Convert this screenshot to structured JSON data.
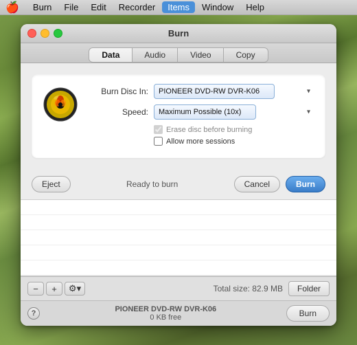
{
  "menubar": {
    "apple": "🍎",
    "items": [
      {
        "id": "burn",
        "label": "Burn",
        "active": false
      },
      {
        "id": "file",
        "label": "File",
        "active": false
      },
      {
        "id": "edit",
        "label": "Edit",
        "active": false
      },
      {
        "id": "recorder",
        "label": "Recorder",
        "active": false
      },
      {
        "id": "items",
        "label": "Items",
        "active": true
      },
      {
        "id": "window",
        "label": "Window",
        "active": false
      },
      {
        "id": "help",
        "label": "Help",
        "active": false
      }
    ]
  },
  "window": {
    "title": "Burn",
    "tabs": [
      {
        "id": "data",
        "label": "Data",
        "active": true
      },
      {
        "id": "audio",
        "label": "Audio",
        "active": false
      },
      {
        "id": "video",
        "label": "Video",
        "active": false
      },
      {
        "id": "copy",
        "label": "Copy",
        "active": false
      }
    ]
  },
  "burn_options": {
    "disc_in_label": "Burn Disc In:",
    "disc_in_value": "PIONEER DVD-RW DVR-K06",
    "speed_label": "Speed:",
    "speed_value": "Maximum Possible (10x)",
    "erase_label": "Erase disc before burning",
    "allow_sessions_label": "Allow more sessions"
  },
  "buttons": {
    "eject": "Eject",
    "cancel": "Cancel",
    "burn": "Burn",
    "folder": "Folder",
    "help": "?"
  },
  "status": {
    "ready": "Ready to burn"
  },
  "bottom": {
    "total_size": "Total size: 82.9 MB",
    "disc_name": "PIONEER DVD-RW DVR-K06",
    "disc_free": "0 KB free"
  },
  "icons": {
    "minus": "−",
    "plus": "+",
    "gear": "⚙"
  }
}
